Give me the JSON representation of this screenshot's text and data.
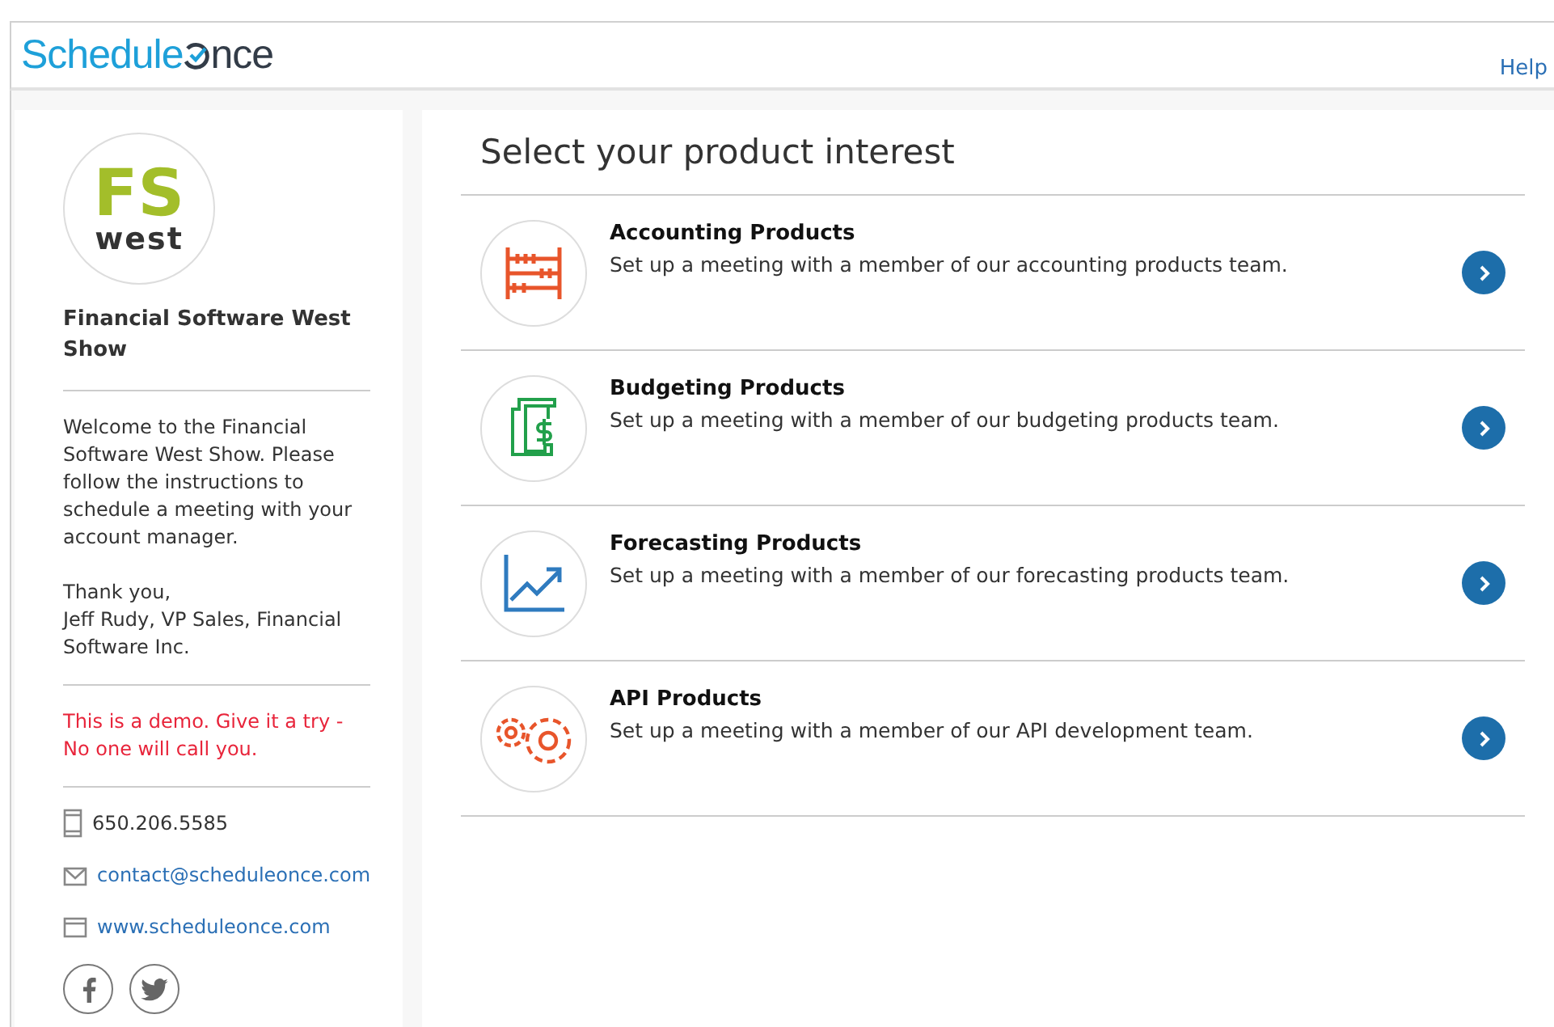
{
  "header": {
    "logo": {
      "first": "Schedule",
      "last": "nce"
    },
    "help_link": "Help"
  },
  "sidebar": {
    "badge": {
      "top": "FS",
      "bottom": "west"
    },
    "title": "Financial Software West Show",
    "welcome": "Welcome to the Financial Software West Show. Please follow the instructions to schedule a meeting with your account manager.",
    "thanks": [
      "Thank you,",
      "Jeff Rudy, VP Sales, Financial Software Inc."
    ],
    "notice": "This is a demo. Give it a try - No one will call you.",
    "contacts": [
      {
        "kind": "phone",
        "text": "650.206.5585"
      },
      {
        "kind": "email",
        "text": "contact@scheduleonce.com"
      },
      {
        "kind": "web",
        "text": "www.scheduleonce.com"
      }
    ],
    "social": [
      {
        "kind": "facebook"
      },
      {
        "kind": "twitter"
      }
    ]
  },
  "main": {
    "title": "Select your product interest",
    "products": [
      {
        "kind": "abacus",
        "color": "#e8552b",
        "name": "Accounting Products",
        "description": "Set up a meeting with a member of our accounting products team."
      },
      {
        "kind": "clamp",
        "color": "#22a04b",
        "name": "Budgeting Products",
        "description": "Set up a meeting with a member of our budgeting products team."
      },
      {
        "kind": "chart",
        "color": "#2f7bbf",
        "name": "Forecasting Products",
        "description": "Set up a meeting with a member of our forecasting products team."
      },
      {
        "kind": "gears",
        "color": "#e8552b",
        "name": "API Products",
        "description": "Set up a meeting with a member of our API development team."
      }
    ]
  }
}
